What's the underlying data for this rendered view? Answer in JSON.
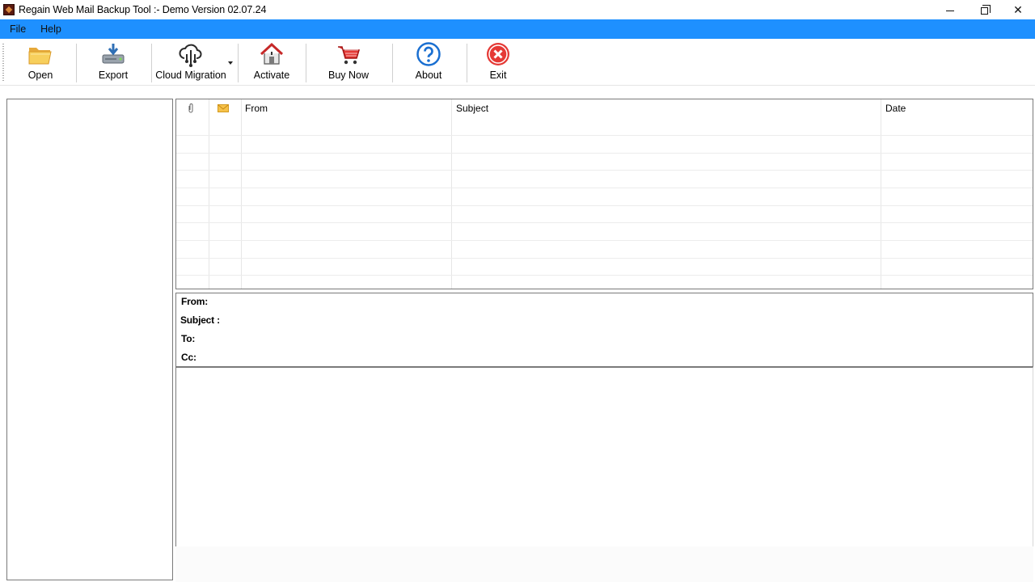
{
  "window": {
    "title": "Regain Web Mail Backup Tool :- Demo Version 02.07.24",
    "icons": {
      "app": "app-logo-icon",
      "minimize": "minimize-icon",
      "restore": "restore-icon",
      "close": "close-icon"
    },
    "close_glyph": "✕"
  },
  "menu": {
    "items": [
      "File",
      "Help"
    ]
  },
  "toolbar": {
    "buttons": [
      {
        "label": "Open",
        "icon": "folder-open-icon"
      },
      {
        "label": "Export",
        "icon": "export-drive-icon"
      },
      {
        "label": "Cloud Migration",
        "icon": "cloud-migration-icon"
      },
      {
        "label": "Activate",
        "icon": "activate-home-icon"
      },
      {
        "label": "Buy Now",
        "icon": "shopping-cart-icon"
      },
      {
        "label": "About",
        "icon": "help-circle-icon"
      },
      {
        "label": "Exit",
        "icon": "exit-circle-icon"
      }
    ],
    "dropdown_icon": "chevron-down-icon"
  },
  "mail_list": {
    "columns": [
      "",
      "",
      "From",
      "Subject",
      "Date"
    ],
    "column_icons": [
      "attachment-icon",
      "envelope-icon"
    ]
  },
  "mail_header": {
    "from_label": "From:",
    "subject_label": "Subject :",
    "to_label": "To:",
    "cc_label": "Cc:"
  },
  "colors": {
    "menubar": "#1e90ff",
    "exit_red": "#e53935",
    "about_blue": "#1a6fd1"
  }
}
